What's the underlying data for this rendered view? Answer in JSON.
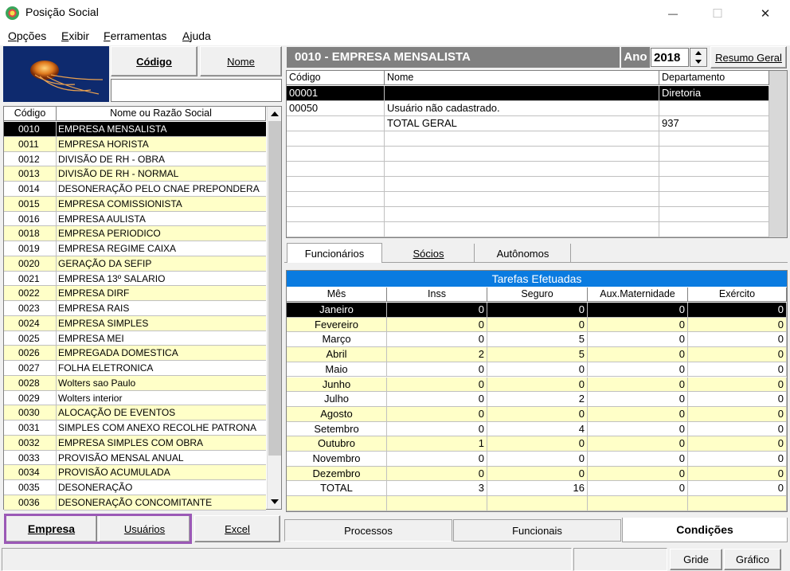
{
  "window": {
    "title": "Posição Social",
    "minimize": "—",
    "maximize": "☐",
    "close": "✕"
  },
  "menu": {
    "items": [
      "Opções",
      "Exibir",
      "Ferramentas",
      "Ajuda"
    ],
    "underline": [
      "O",
      "E",
      "F",
      "A"
    ]
  },
  "left": {
    "codigo_btn": "Código",
    "nome_btn": "Nome",
    "search_value": "",
    "headers": [
      "Código",
      "Nome ou Razão Social"
    ],
    "rows": [
      [
        "0010",
        "EMPRESA MENSALISTA"
      ],
      [
        "0011",
        "EMPRESA HORISTA"
      ],
      [
        "0012",
        "DIVISÃO DE RH - OBRA"
      ],
      [
        "0013",
        "DIVISÃO DE RH - NORMAL"
      ],
      [
        "0014",
        "DESONERAÇÃO PELO CNAE PREPONDERA"
      ],
      [
        "0015",
        "EMPRESA COMISSIONISTA"
      ],
      [
        "0016",
        "EMPRESA AULISTA"
      ],
      [
        "0018",
        "EMPRESA PERIODICO"
      ],
      [
        "0019",
        "EMPRESA REGIME CAIXA"
      ],
      [
        "0020",
        "GERAÇÃO DA SEFIP"
      ],
      [
        "0021",
        "EMPRESA 13º SALARIO"
      ],
      [
        "0022",
        "EMPRESA DIRF"
      ],
      [
        "0023",
        "EMPRESA RAIS"
      ],
      [
        "0024",
        "EMPRESA SIMPLES"
      ],
      [
        "0025",
        "EMPRESA MEI"
      ],
      [
        "0026",
        "EMPREGADA DOMESTICA"
      ],
      [
        "0027",
        "FOLHA ELETRONICA"
      ],
      [
        "0028",
        "Wolters sao Paulo"
      ],
      [
        "0029",
        "Wolters interior"
      ],
      [
        "0030",
        "ALOCAÇÃO DE EVENTOS"
      ],
      [
        "0031",
        "SIMPLES COM ANEXO RECOLHE PATRONA"
      ],
      [
        "0032",
        "EMPRESA SIMPLES COM OBRA"
      ],
      [
        "0033",
        "PROVISÃO MENSAL ANUAL"
      ],
      [
        "0034",
        "PROVISÃO ACUMULADA"
      ],
      [
        "0035",
        "DESONERAÇÃO"
      ],
      [
        "0036",
        "DESONERAÇÃO CONCOMITANTE"
      ]
    ],
    "bottom_buttons": [
      "Empresa",
      "Usuários",
      "Excel"
    ],
    "highlight_color": "#9b59b6"
  },
  "right": {
    "company_title": "0010 - EMPRESA MENSALISTA",
    "ano_label": "Ano",
    "ano_value": "2018",
    "resumo_btn": "Resumo Geral",
    "dept_headers": [
      "Código",
      "Nome",
      "Departamento"
    ],
    "dept_rows": [
      [
        "00001",
        "",
        "Diretoria"
      ],
      [
        "00050",
        "Usuário não cadastrado.",
        ""
      ],
      [
        "",
        "TOTAL GERAL",
        "937"
      ]
    ],
    "tabs": [
      "Funcionários",
      "Sócios",
      "Autônomos"
    ],
    "tasks_title": "Tarefas Efetuadas",
    "task_headers": [
      "Mês",
      "Inss",
      "Seguro",
      "Aux.Maternidade",
      "Exército"
    ],
    "task_rows": [
      [
        "Janeiro",
        "0",
        "0",
        "0",
        "0"
      ],
      [
        "Fevereiro",
        "0",
        "0",
        "0",
        "0"
      ],
      [
        "Março",
        "0",
        "5",
        "0",
        "0"
      ],
      [
        "Abril",
        "2",
        "5",
        "0",
        "0"
      ],
      [
        "Maio",
        "0",
        "0",
        "0",
        "0"
      ],
      [
        "Junho",
        "0",
        "0",
        "0",
        "0"
      ],
      [
        "Julho",
        "0",
        "2",
        "0",
        "0"
      ],
      [
        "Agosto",
        "0",
        "0",
        "0",
        "0"
      ],
      [
        "Setembro",
        "0",
        "4",
        "0",
        "0"
      ],
      [
        "Outubro",
        "1",
        "0",
        "0",
        "0"
      ],
      [
        "Novembro",
        "0",
        "0",
        "0",
        "0"
      ],
      [
        "Dezembro",
        "0",
        "0",
        "0",
        "0"
      ],
      [
        "TOTAL",
        "3",
        "16",
        "0",
        "0"
      ]
    ],
    "bottom_tabs": [
      "Processos",
      "Funcionais",
      "Condições"
    ],
    "status_buttons": [
      "Gride",
      "Gráfico"
    ]
  },
  "colors": {
    "title_bar": "#808080",
    "tasks_bar": "#0a7be0",
    "row_alt": "#ffffc8",
    "selected": "#000000"
  }
}
